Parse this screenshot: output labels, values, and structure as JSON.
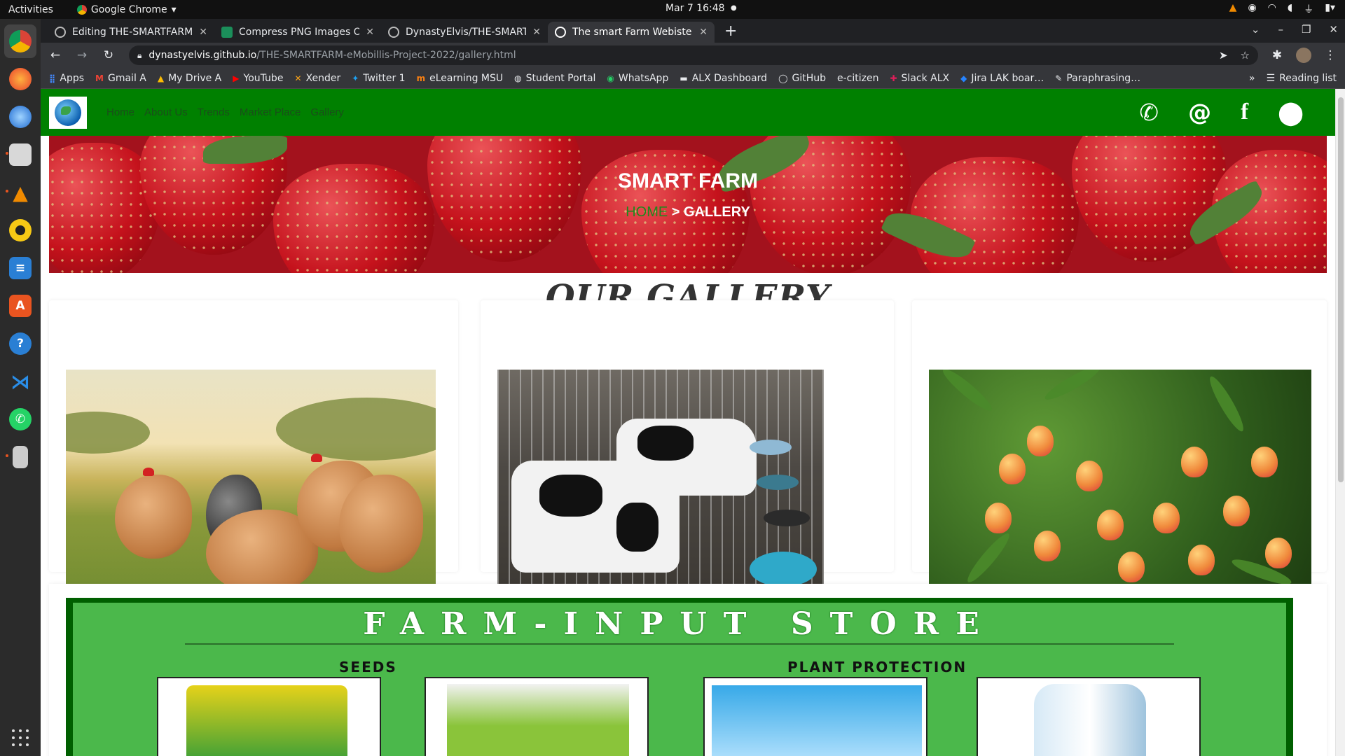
{
  "os": {
    "activities": "Activities",
    "app_menu": "Google Chrome",
    "clock": "Mar 7  16:48"
  },
  "browser": {
    "tabs": [
      {
        "title": "Editing THE-SMARTFARM-",
        "active": false
      },
      {
        "title": "Compress PNG Images Or",
        "active": false
      },
      {
        "title": "DynastyElvis/THE-SMART",
        "active": false
      },
      {
        "title": "The smart Farm Webiste",
        "active": true
      }
    ],
    "url_host": "dynastyelvis.github.io",
    "url_path": "/THE-SMARTFARM-eMobillis-Project-2022/gallery.html",
    "bookmarks": [
      {
        "label": "Apps",
        "icon": "apps-grid-icon"
      },
      {
        "label": "Gmail A",
        "icon": "gmail-icon"
      },
      {
        "label": "My Drive A",
        "icon": "drive-icon"
      },
      {
        "label": "YouTube",
        "icon": "youtube-icon"
      },
      {
        "label": "Xender",
        "icon": "xender-icon"
      },
      {
        "label": "Twitter 1",
        "icon": "twitter-icon"
      },
      {
        "label": "eLearning MSU",
        "icon": "elearning-icon"
      },
      {
        "label": "Student Portal",
        "icon": "portal-icon"
      },
      {
        "label": "WhatsApp",
        "icon": "whatsapp-icon"
      },
      {
        "label": "ALX Dashboard",
        "icon": "alx-icon"
      },
      {
        "label": "GitHub",
        "icon": "github-icon"
      },
      {
        "label": "e-citizen",
        "icon": "ecitizen-icon"
      },
      {
        "label": "Slack ALX",
        "icon": "slack-icon"
      },
      {
        "label": "Jira LAK boar…",
        "icon": "jira-icon"
      },
      {
        "label": "Paraphrasing…",
        "icon": "quill-icon"
      }
    ],
    "more": "»",
    "reading_list": "Reading list"
  },
  "site": {
    "nav": [
      "Home",
      "About Us",
      "Trends",
      "Market Place",
      "Gallery"
    ],
    "hero_title": "SMART FARM",
    "crumb_home": "HOME",
    "crumb_rest": " > GALLERY",
    "gallery_title": "OUR GALLERY",
    "store": {
      "title": "FARM-INPUT STORE",
      "section_seeds": "SEEDS",
      "section_protection": "PLANT PROTECTION"
    }
  },
  "colors": {
    "nav_green": "#008000",
    "nav_link": "#1a4d1a",
    "crumb_home": "#1c8a1c",
    "store_bg": "#4bb84b"
  }
}
